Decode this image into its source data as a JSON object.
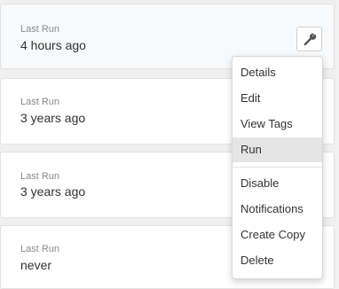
{
  "jobs": [
    {
      "label": "Last Run",
      "value": "4 hours ago"
    },
    {
      "label": "Last Run",
      "value": "3 years ago"
    },
    {
      "label": "Last Run",
      "value": "3 years ago"
    },
    {
      "label": "Last Run",
      "value": "never"
    }
  ],
  "actions_button": {
    "icon": "wrench-icon"
  },
  "menu": {
    "items": [
      {
        "label": "Details"
      },
      {
        "label": "Edit"
      },
      {
        "label": "View Tags"
      },
      {
        "label": "Run"
      },
      {
        "label": "Disable"
      },
      {
        "label": "Notifications"
      },
      {
        "label": "Create Copy"
      },
      {
        "label": "Delete"
      }
    ],
    "highlighted_item": "Run"
  },
  "colors": {
    "text": "#333333",
    "muted": "#8a8a8a",
    "highlight": "#e5e5e5",
    "icon": "#555555"
  }
}
